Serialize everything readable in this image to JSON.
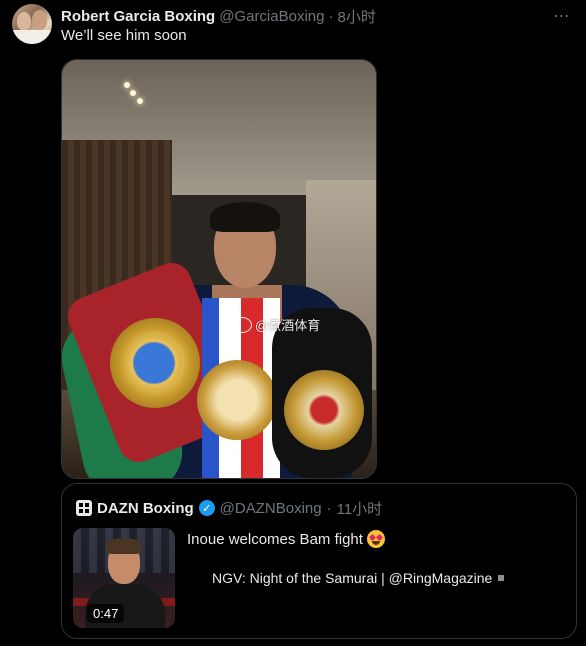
{
  "tweet": {
    "author_name": "Robert Garcia Boxing",
    "handle": "@GarciaBoxing",
    "separator": "·",
    "time": "8小时",
    "text": "We’ll see him soon",
    "more_icon": "more-dots-icon"
  },
  "media": {
    "watermark": "@煮酒体育"
  },
  "quote": {
    "author_name": "DAZN Boxing",
    "handle": "@DAZNBoxing",
    "separator": "·",
    "time": "11小时",
    "text": "Inoue welcomes Bam fight",
    "subtext": "NGV: Night of the Samurai | @RingMagazine",
    "video_duration": "0:47",
    "verified_color": "#1d9bf0"
  }
}
